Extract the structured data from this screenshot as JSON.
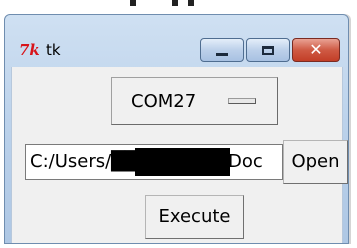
{
  "window": {
    "title": "tk",
    "app_icon_text": "7k",
    "caption_buttons": {
      "close_glyph": "✕"
    }
  },
  "port_menu": {
    "selected": "COM27"
  },
  "path_entry": {
    "value": "C:/Users/████████/Doc"
  },
  "buttons": {
    "open_label": "Open",
    "execute_label": "Execute"
  },
  "colors": {
    "tk_icon": "#d8141b",
    "close_button": "#c7432c",
    "frame": "#b9d0ea",
    "client_bg": "#f0f0f0"
  }
}
